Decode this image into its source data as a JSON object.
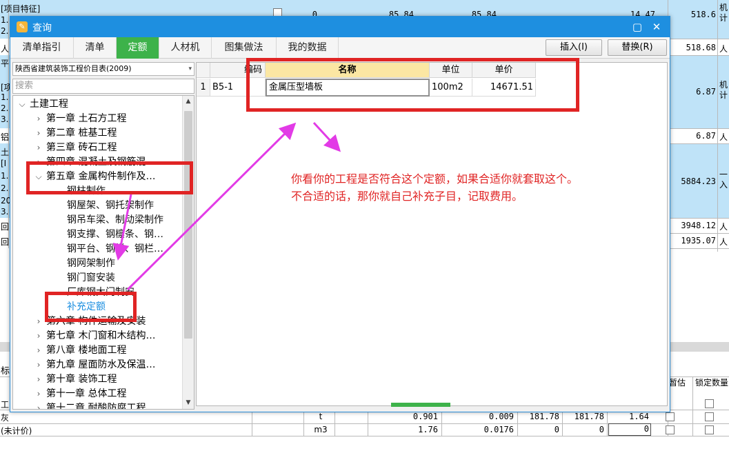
{
  "background_sheet": {
    "rows": [
      {
        "label": "[项目特征]",
        "value": ""
      },
      {
        "label": "1.",
        "value": "518.6",
        "unit": "机计"
      },
      {
        "label": "2.",
        "value": ""
      },
      {
        "label": "人",
        "value": "518.68",
        "unit": "人"
      },
      {
        "label": "平",
        "value": ""
      },
      {
        "label": "[项",
        "value": "6.87",
        "unit": "机计"
      },
      {
        "label": "1.",
        "value": ""
      },
      {
        "label": "2.",
        "value": ""
      },
      {
        "label": "3.",
        "value": ""
      },
      {
        "label": "铝",
        "value": "6.87",
        "unit": "人"
      },
      {
        "label": "土",
        "value": ""
      },
      {
        "label": "[I",
        "value": "5884.23",
        "unit": "一入"
      },
      {
        "label": "1.",
        "value": ""
      },
      {
        "label": "2.",
        "value": ""
      },
      {
        "label": "20",
        "value": ""
      },
      {
        "label": "3.",
        "value": ""
      },
      {
        "label": "回",
        "value": "3948.12",
        "unit": "人"
      },
      {
        "label": "回",
        "value": "1935.07",
        "unit": "人"
      }
    ],
    "top_partial_values": [
      "0",
      "85.84",
      "85.84",
      "14.47"
    ],
    "bottom_headers": {
      "left": "标",
      "provisional": "暂估",
      "lock_qty": "锁定数量"
    },
    "bottom_rows": [
      {
        "label": "工",
        "unit": "",
        "qty": "",
        "coef": "",
        "p1": "",
        "p2": "",
        "amount": ""
      },
      {
        "label": "灰",
        "unit": "t",
        "qty": "0.901",
        "coef": "0.009",
        "p1": "181.78",
        "p2": "181.78",
        "amount": "1.64"
      },
      {
        "label": "(未计价)",
        "unit": "m3",
        "qty": "1.76",
        "coef": "0.0176",
        "p1": "0",
        "p2": "0",
        "amount": "0"
      }
    ]
  },
  "dialog": {
    "title": "查询",
    "title_icon": "app-icon",
    "maximize_glyph": "▢",
    "close_glyph": "✕",
    "tabs": [
      {
        "label": "清单指引",
        "active": false
      },
      {
        "label": "清单",
        "active": false
      },
      {
        "label": "定额",
        "active": true
      },
      {
        "label": "人材机",
        "active": false
      },
      {
        "label": "图集做法",
        "active": false
      },
      {
        "label": "我的数据",
        "active": false
      }
    ],
    "insert_button": "插入(I)",
    "replace_button": "替换(R)",
    "library_select": "陕西省建筑装饰工程价目表(2009)",
    "search_placeholder": "搜索",
    "tree": [
      {
        "label": "土建工程",
        "level": 0,
        "state": "expanded"
      },
      {
        "label": "第一章  土石方工程",
        "level": 1,
        "state": "collapsed"
      },
      {
        "label": "第二章  桩基工程",
        "level": 1,
        "state": "collapsed"
      },
      {
        "label": "第三章  砖石工程",
        "level": 1,
        "state": "collapsed"
      },
      {
        "label": "第四章  混凝土及钢筋混…",
        "level": 1,
        "state": "collapsed"
      },
      {
        "label": "第五章  金属构件制作及…",
        "level": 1,
        "state": "expanded"
      },
      {
        "label": "钢柱制作",
        "level": 2,
        "state": "leaf"
      },
      {
        "label": "钢屋架、钢托架制作",
        "level": 2,
        "state": "leaf"
      },
      {
        "label": "钢吊车梁、制动梁制作",
        "level": 2,
        "state": "leaf"
      },
      {
        "label": "钢支撑、钢檩条、钢…",
        "level": 2,
        "state": "leaf"
      },
      {
        "label": "钢平台、钢梯、钢栏…",
        "level": 2,
        "state": "leaf"
      },
      {
        "label": "钢网架制作",
        "level": 2,
        "state": "leaf"
      },
      {
        "label": "钢门窗安装",
        "level": 2,
        "state": "leaf"
      },
      {
        "label": "厂库钢大门制安",
        "level": 2,
        "state": "leaf"
      },
      {
        "label": "补充定额",
        "level": 2,
        "state": "link"
      },
      {
        "label": "第六章  构件运输及安装",
        "level": 1,
        "state": "collapsed"
      },
      {
        "label": "第七章  木门窗和木结构…",
        "level": 1,
        "state": "collapsed"
      },
      {
        "label": "第八章  楼地面工程",
        "level": 1,
        "state": "collapsed"
      },
      {
        "label": "第九章  屋面防水及保温…",
        "level": 1,
        "state": "collapsed"
      },
      {
        "label": "第十章  装饰工程",
        "level": 1,
        "state": "collapsed"
      },
      {
        "label": "第十一章  总体工程",
        "level": 1,
        "state": "collapsed"
      },
      {
        "label": "第十二章  耐酸防腐工程",
        "level": 1,
        "state": "collapsed"
      }
    ],
    "grid": {
      "headers": {
        "code": "编码",
        "name": "名称",
        "unit": "单位",
        "price": "单价"
      },
      "rows": [
        {
          "index": "1",
          "code": "B5-1",
          "name": "金属压型墙板",
          "unit": "100m2",
          "price": "14671.51"
        }
      ]
    }
  },
  "annotation": {
    "note_line1": "你看你的工程是否符合这个定额，如果合适你就套取这个。",
    "note_line2": "不合适的话，那你就自己补充子目，记取费用。",
    "box_color": "#e02424",
    "arrow_color": "#e23be6"
  },
  "colors": {
    "titlebar": "#1e8fe0",
    "active_tab": "#3db24a",
    "sheet_band": "#bfe3f8",
    "name_header": "#fbe7a3"
  }
}
